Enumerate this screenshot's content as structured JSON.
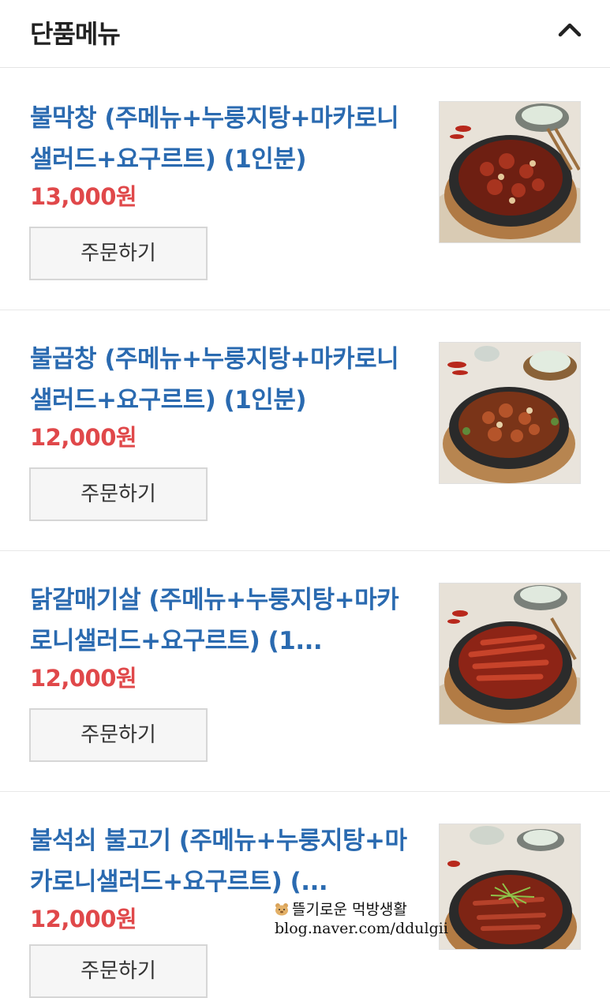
{
  "header": {
    "title": "단품메뉴",
    "toggle_icon": "chevron-up-icon"
  },
  "items": [
    {
      "title": "불막창 (주메뉴+누룽지탕+마카로니샐러드+요구르트) (1인분)",
      "price": "13,000원",
      "order_label": "주문하기"
    },
    {
      "title": "불곱창 (주메뉴+누룽지탕+마카로니샐러드+요구르트) (1인분)",
      "price": "12,000원",
      "order_label": "주문하기"
    },
    {
      "title": "닭갈매기살 (주메뉴+누룽지탕+마카로니샐러드+요구르트) (1...",
      "price": "12,000원",
      "order_label": "주문하기"
    },
    {
      "title": "불석쇠 불고기 (주메뉴+누룽지탕+마카로니샐러드+요구르트) (...",
      "price": "12,000원",
      "order_label": "주문하기"
    }
  ],
  "watermark": {
    "line1": "뜰기로운 먹방생활",
    "line2": "blog.naver.com/ddulgii"
  },
  "colors": {
    "title_blue": "#2a6ab0",
    "price_red": "#e0484a",
    "button_bg": "#f6f6f6"
  }
}
